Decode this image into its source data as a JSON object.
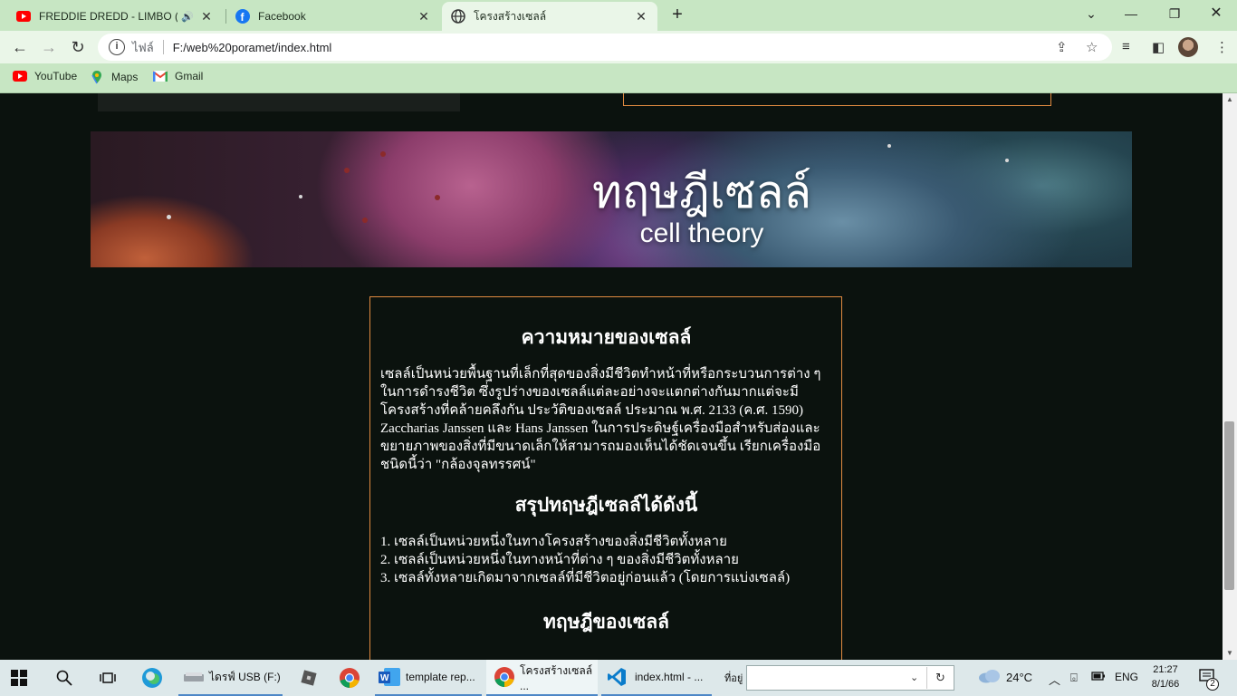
{
  "browser": {
    "tabs": [
      {
        "label": "FREDDIE DREDD - LIMBO (G",
        "icon": "youtube-icon",
        "active": false
      },
      {
        "label": "Facebook",
        "icon": "facebook-icon",
        "active": false
      },
      {
        "label": "โครงสร้างเซลล์",
        "icon": "globe-icon",
        "active": true
      }
    ],
    "address": {
      "scheme_label": "ไฟล์",
      "url": "F:/web%20poramet/index.html"
    },
    "bookmarks": [
      {
        "label": "YouTube",
        "icon": "youtube-icon"
      },
      {
        "label": "Maps",
        "icon": "maps-icon"
      },
      {
        "label": "Gmail",
        "icon": "gmail-icon"
      }
    ],
    "colors": {
      "chrome": "#c7e6c3",
      "accent_border": "#e08a40"
    }
  },
  "page": {
    "banner": {
      "title": "ทฤษฎีเซลล์",
      "subtitle": "cell theory"
    },
    "section1": {
      "heading": "ความหมายของเซลล์",
      "body": "เซลล์เป็นหน่วยพื้นฐานที่เล็กที่สุดของสิ่งมีชีวิตทำหน้าที่หรือกระบวนการต่าง ๆ ในการดำรงชีวิต ซึ่งรูปร่างของเซลล์แต่ละอย่างจะแตกต่างกันมากแต่จะมีโครงสร้างที่คล้ายคลึงกัน ประวัติของเซลล์ ประมาณ พ.ศ. 2133 (ค.ศ. 1590) Zaccharias Janssen และ Hans Janssen ในการประดิษฐ์เครื่องมือสำหรับส่องและขยายภาพของสิ่งที่มีขนาดเล็กให้สามารถมองเห็นได้ชัดเจนขึ้น เรียกเครื่องมือชนิดนี้ว่า \"กล้องจุลทรรศน์\""
    },
    "section2": {
      "heading": "สรุปทฤษฎีเซลล์ได้ดังนี้",
      "items": [
        "1. เซลล์เป็นหน่วยหนึ่งในทางโครงสร้างของสิ่งมีชีวิตทั้งหลาย",
        "2. เซลล์เป็นหน่วยหนึ่งในทางหน้าที่ต่าง ๆ ของสิ่งมีชีวิตทั้งหลาย",
        "3. เซลล์ทั้งหลายเกิดมาจากเซลล์ที่มีชีวิตอยู่ก่อนแล้ว (โดยการแบ่งเซลล์)"
      ]
    },
    "section3": {
      "heading": "ทฤษฎีของเซลล์"
    }
  },
  "taskbar": {
    "apps": [
      {
        "label": "ไดรฟ์ USB (F:)",
        "icon": "usb-drive-icon"
      },
      {
        "label": "template rep...",
        "icon": "word-icon"
      },
      {
        "label": "โครงสร้างเซลล์ ...",
        "icon": "chrome-icon"
      },
      {
        "label": "index.html - ...",
        "icon": "vscode-icon"
      }
    ],
    "address_label": "ที่อยู่",
    "weather": "24°C",
    "language": "ENG",
    "time": "21:27",
    "date": "8/1/66",
    "notification_count": "2"
  }
}
